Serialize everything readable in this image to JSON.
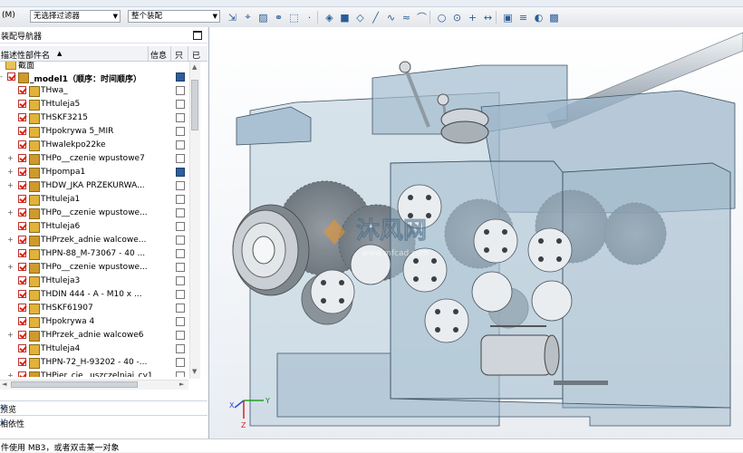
{
  "toolbar": {
    "menu_label": "(M)",
    "filter_combo": "无选择过滤器",
    "scope_combo": "整个装配",
    "icons": [
      "move-icon",
      "snap-icon",
      "color-icon",
      "link-icon",
      "select-icon",
      "point-icon",
      "view-cube-icon",
      "shaded-icon",
      "wireframe-icon",
      "line-icon",
      "curve-icon",
      "spline-icon",
      "arc-icon",
      "circle-icon",
      "center-icon",
      "cross-icon",
      "dimension-icon",
      "display-icon",
      "layer-icon",
      "render-icon",
      "camera-icon"
    ]
  },
  "navigator": {
    "title": "装配导航器",
    "columns": {
      "name": "描述性部件名",
      "info": "信息",
      "ro": "只",
      "extra": "已"
    },
    "rows": [
      {
        "label": "截面",
        "type": "folder",
        "expander": "",
        "status": ""
      },
      {
        "label": "_model1（顺序：时间顺序）",
        "type": "root",
        "expander": "-",
        "status": "disk"
      },
      {
        "label": "THwa_",
        "type": "part",
        "expander": "",
        "status": "box"
      },
      {
        "label": "THtuleja5",
        "type": "part",
        "expander": "",
        "status": "box"
      },
      {
        "label": "THSKF3215",
        "type": "part",
        "expander": "",
        "status": "box"
      },
      {
        "label": "THpokrywa 5_MIR",
        "type": "part",
        "expander": "",
        "status": "box"
      },
      {
        "label": "THwalekpo22ke",
        "type": "part",
        "expander": "",
        "status": "box"
      },
      {
        "label": "THPo__czenie wpustowe7",
        "type": "asm",
        "expander": "+",
        "status": "box"
      },
      {
        "label": "THpompa1",
        "type": "asm",
        "expander": "+",
        "status": "disk"
      },
      {
        "label": "THDW_JKA PRZEKURWA...",
        "type": "asm",
        "expander": "+",
        "status": "box"
      },
      {
        "label": "THtuleja1",
        "type": "part",
        "expander": "",
        "status": "box"
      },
      {
        "label": "THPo__czenie wpustowe...",
        "type": "asm",
        "expander": "+",
        "status": "box"
      },
      {
        "label": "THtuleja6",
        "type": "part",
        "expander": "",
        "status": "box"
      },
      {
        "label": "THPrzek_adnie walcowe...",
        "type": "asm",
        "expander": "+",
        "status": "box"
      },
      {
        "label": "THPN-88_M-73067 - 40 ...",
        "type": "part",
        "expander": "",
        "status": "box"
      },
      {
        "label": "THPo__czenie wpustowe...",
        "type": "asm",
        "expander": "+",
        "status": "box"
      },
      {
        "label": "THtuleja3",
        "type": "part",
        "expander": "",
        "status": "box"
      },
      {
        "label": "THDIN 444 - A - M10 x ...",
        "type": "part",
        "expander": "",
        "status": "box"
      },
      {
        "label": "THSKF61907",
        "type": "part",
        "expander": "",
        "status": "box"
      },
      {
        "label": "THpokrywa 4",
        "type": "part",
        "expander": "",
        "status": "box"
      },
      {
        "label": "THPrzek_adnie walcowe6",
        "type": "asm",
        "expander": "+",
        "status": "box"
      },
      {
        "label": "THtuleja4",
        "type": "part",
        "expander": "",
        "status": "box"
      },
      {
        "label": "THPN-72_H-93202 - 40 -...",
        "type": "part",
        "expander": "",
        "status": "box"
      },
      {
        "label": "THPier_cie_ uszczelniaj_cy1",
        "type": "asm",
        "expander": "+",
        "status": "box"
      }
    ]
  },
  "sections": {
    "preview": "预览",
    "dependency": "相依性"
  },
  "viewport": {
    "watermark_text": "沐风网",
    "watermark_url": "www.mfcad.com",
    "triad_labels": {
      "x": "X",
      "y": "Y",
      "z": "Z"
    }
  },
  "statusbar": {
    "message": "件使用 MB3，或者双击某一对象"
  },
  "colors": {
    "housing": "#9eb8cc",
    "housing_edge": "#3c5466",
    "check_red": "#d22222",
    "accent": "#2a5d9a"
  }
}
